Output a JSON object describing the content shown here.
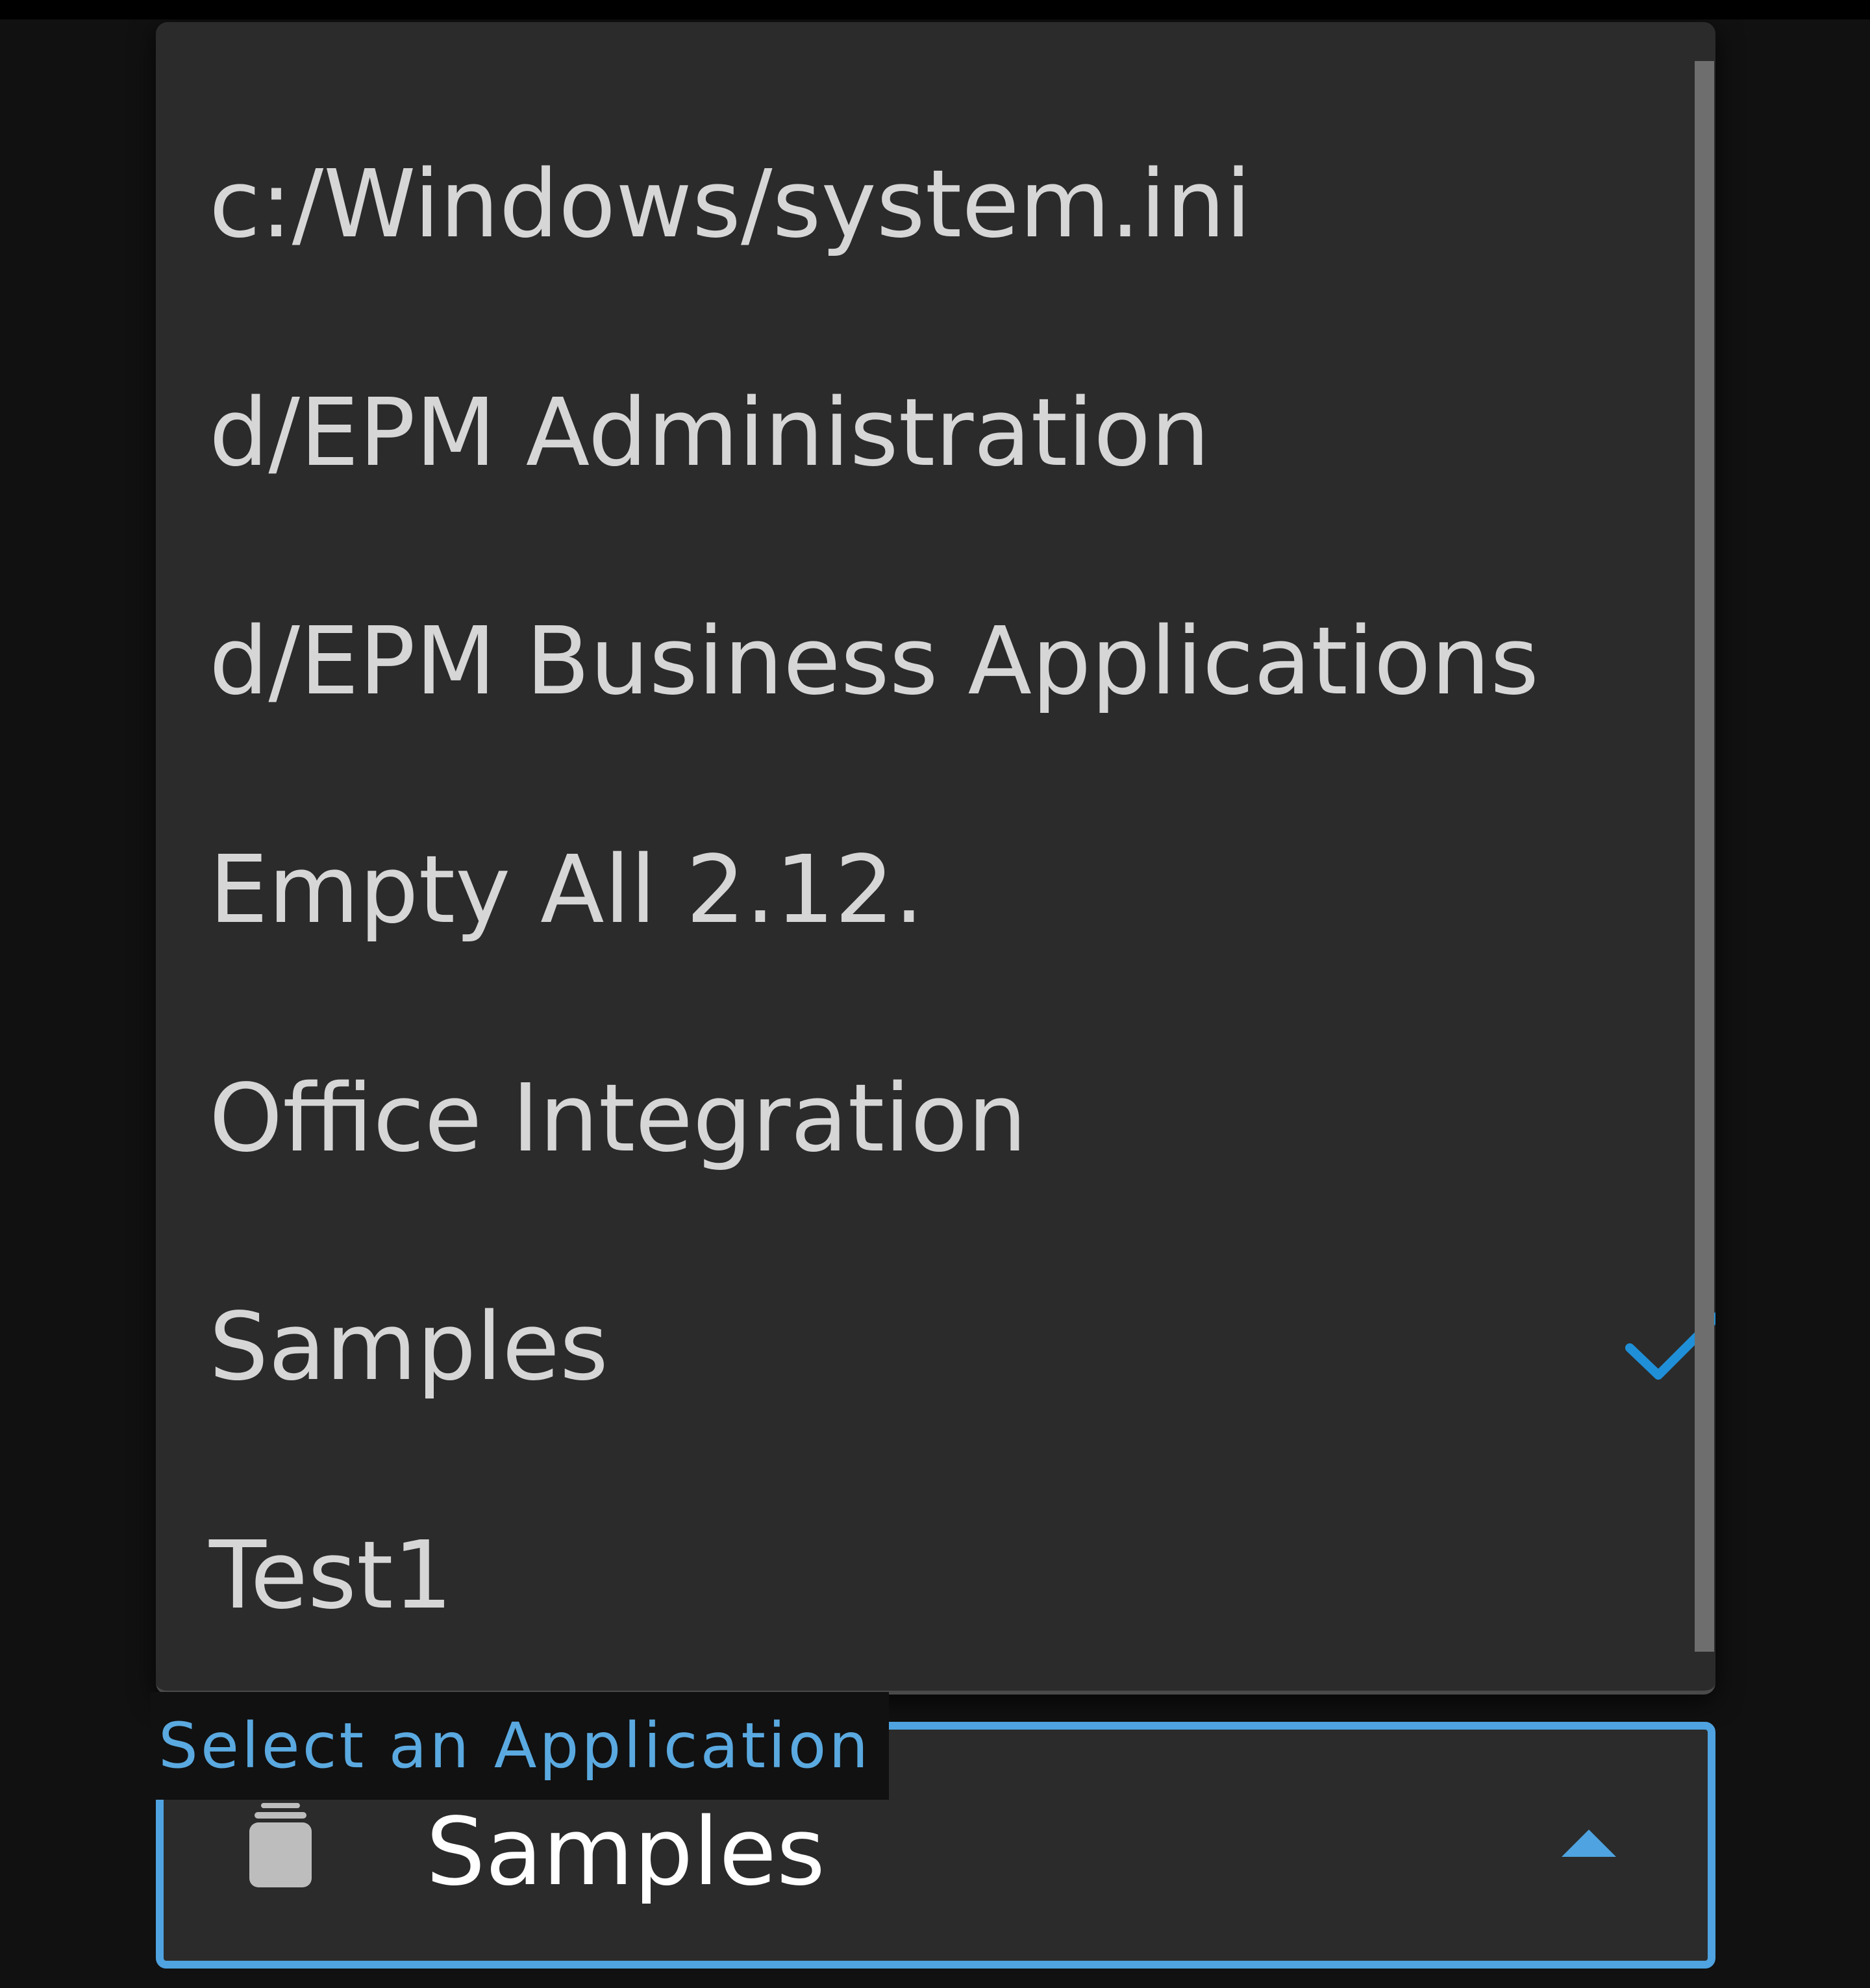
{
  "dropdown": {
    "items": [
      {
        "label": "c:/Windows/system.ini",
        "selected": false
      },
      {
        "label": "d/EPM Administration",
        "selected": false
      },
      {
        "label": "d/EPM Business Applications",
        "selected": false
      },
      {
        "label": "Empty All 2.12.",
        "selected": false
      },
      {
        "label": "Office Integration",
        "selected": false
      },
      {
        "label": "Samples",
        "selected": true
      },
      {
        "label": "Test1",
        "selected": false
      }
    ]
  },
  "select": {
    "label": "Select an Application",
    "value": "Samples",
    "icon": "database-icon",
    "toggle_icon": "caret-up-icon"
  },
  "colors": {
    "accent": "#4ea3e0",
    "check": "#1f8fd8",
    "menu_bg": "#2b2b2b",
    "page_bg": "#111111",
    "item_text": "#d6d6d6"
  }
}
